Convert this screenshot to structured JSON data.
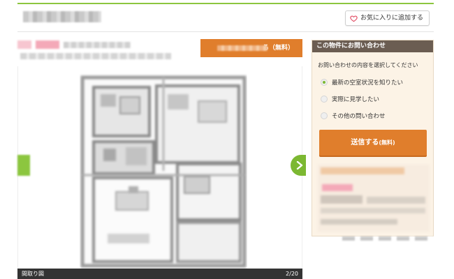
{
  "header": {
    "favorite_label": "お気に入りに追加する"
  },
  "cta_top": {
    "suffix": "る（無料）"
  },
  "gallery": {
    "caption": "間取り図",
    "counter": "2/20"
  },
  "inquiry": {
    "title": "この物件にお問い合わせ",
    "prompt": "お問い合わせの内容を選択してください",
    "options": [
      {
        "label": "最新の空室状況を知りたい",
        "checked": true
      },
      {
        "label": "実際に見学したい",
        "checked": false
      },
      {
        "label": "その他の問い合わせ",
        "checked": false
      }
    ],
    "submit_main": "送信する",
    "submit_small": "(無料)"
  },
  "colors": {
    "accent_green": "#8cc63f",
    "cta_orange": "#e07e2c",
    "panel_header": "#6b5d52",
    "panel_bg": "#fcf3e6"
  },
  "icons": {
    "favorite": "heart-icon",
    "next": "chevron-right-icon",
    "prev": "chevron-left-icon"
  }
}
